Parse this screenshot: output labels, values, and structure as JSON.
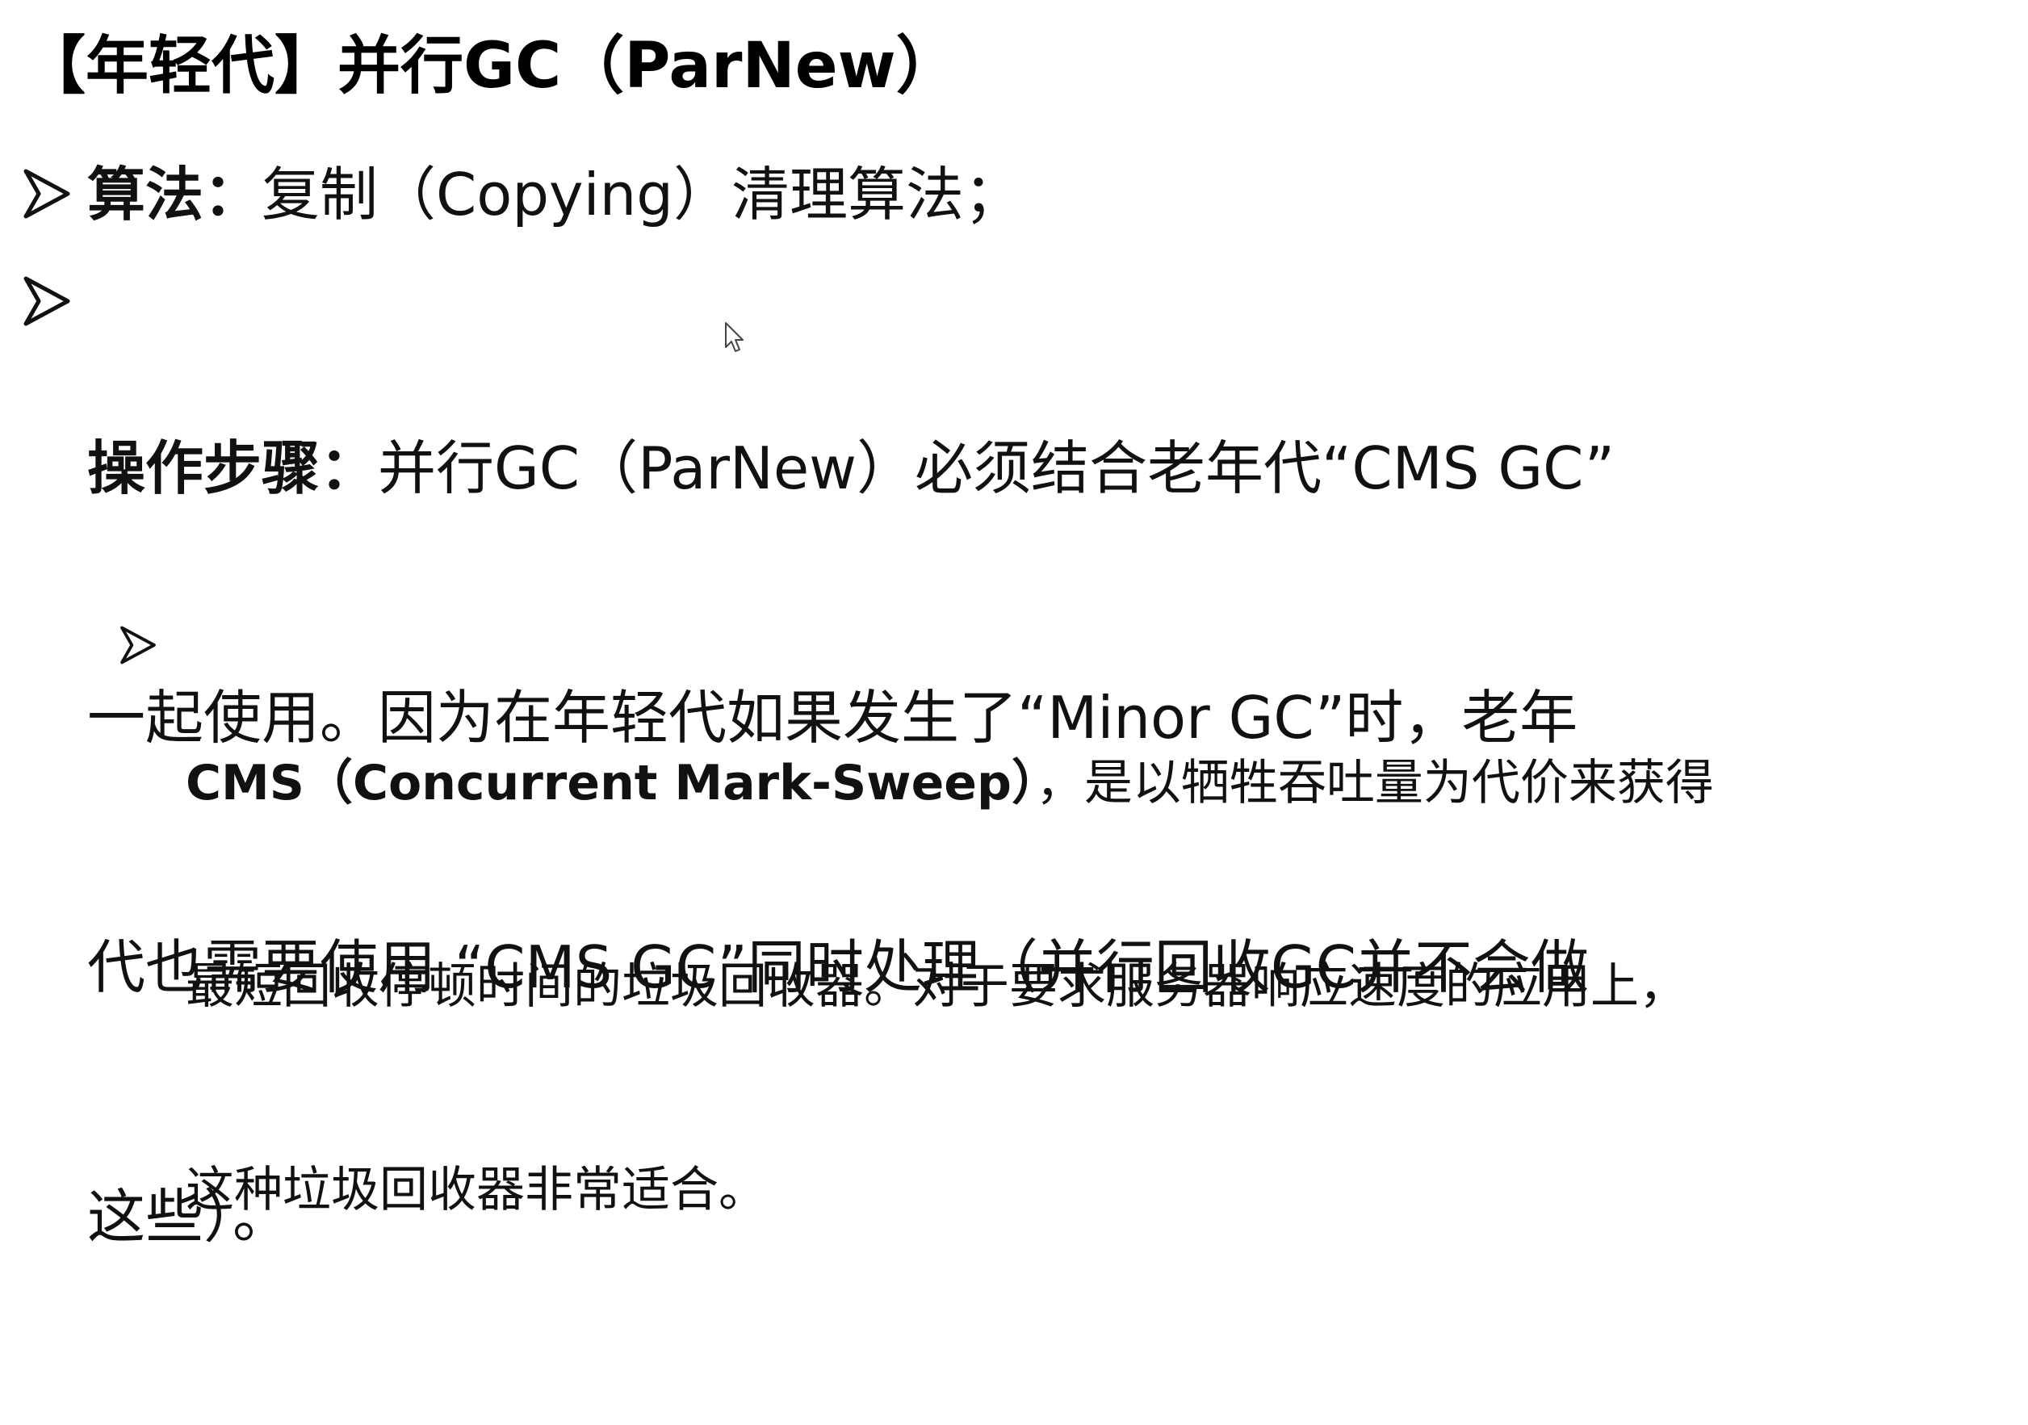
{
  "slide": {
    "title": "【年轻代】并行GC（ParNew）",
    "bullets": [
      {
        "label": "算法：",
        "text": "复制（Copying）清理算法；"
      },
      {
        "label": "操作步骤：",
        "line1": "并行GC（ParNew）必须结合老年代“CMS GC”",
        "line2": "一起使用。因为在年轻代如果发生了“Minor GC”时，老年",
        "line3": "代也需要使用 “CMS GC”同时处理（并行回收GC并不会做",
        "line4": "这些）。"
      }
    ],
    "sub_bullet": {
      "label": "CMS（Concurrent Mark-Sweep）",
      "line1": "，是以牺牲吞吐量为代价来获得",
      "line2": "最短回收停顿时间的垃圾回收器。对于要求服务器响应速度的应用上，",
      "line3": "这种垃圾回收器非常适合。"
    }
  },
  "icons": {
    "bullet": "arrowhead-bullet-icon",
    "cursor": "mouse-pointer-icon"
  }
}
